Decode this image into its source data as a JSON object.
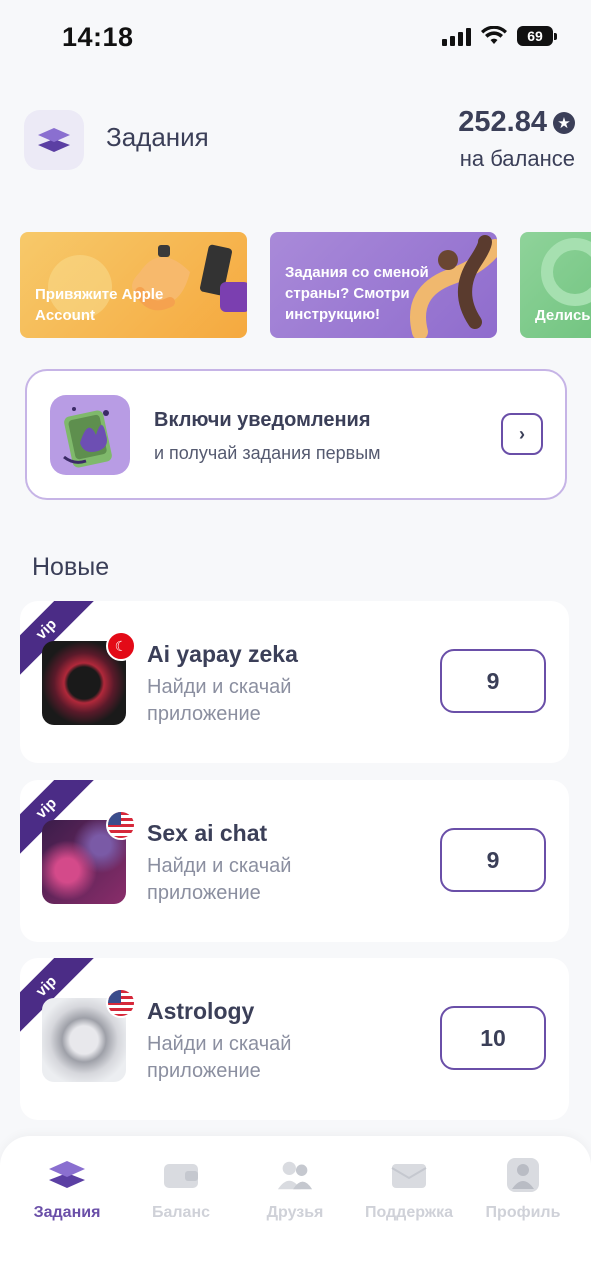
{
  "status_bar": {
    "time": "14:18",
    "battery": "69"
  },
  "header": {
    "title": "Задания",
    "balance": "252.84",
    "balance_caption": "на балансе"
  },
  "banners": [
    {
      "text": "Привяжите Apple Account"
    },
    {
      "text": "Задания со сменой страны? Смотри инструкцию!"
    },
    {
      "text": "Делись"
    }
  ],
  "notify": {
    "title": "Включи уведомления",
    "subtitle": "и получай задания первым"
  },
  "section_title": "Новые",
  "tasks": [
    {
      "badge": "vip",
      "name": "Ai yapay zeka",
      "desc": "Найди и скачай приложение",
      "reward": "9",
      "flag": "turkey-flag-icon"
    },
    {
      "badge": "vip",
      "name": "Sex ai chat",
      "desc": "Найди и скачай приложение",
      "reward": "9",
      "flag": "us-flag-icon"
    },
    {
      "badge": "vip",
      "name": "Astrology",
      "desc": "Найди и скачай приложение",
      "reward": "10",
      "flag": "us-flag-icon"
    }
  ],
  "nav": [
    {
      "label": "Задания",
      "icon": "layers-icon",
      "active": true
    },
    {
      "label": "Баланс",
      "icon": "wallet-icon",
      "active": false
    },
    {
      "label": "Друзья",
      "icon": "friends-icon",
      "active": false
    },
    {
      "label": "Поддержка",
      "icon": "support-icon",
      "active": false
    },
    {
      "label": "Профиль",
      "icon": "profile-icon",
      "active": false
    }
  ],
  "colors": {
    "accent": "#6a4fa8",
    "text": "#3b3f58",
    "vip": "#4b2c86"
  }
}
